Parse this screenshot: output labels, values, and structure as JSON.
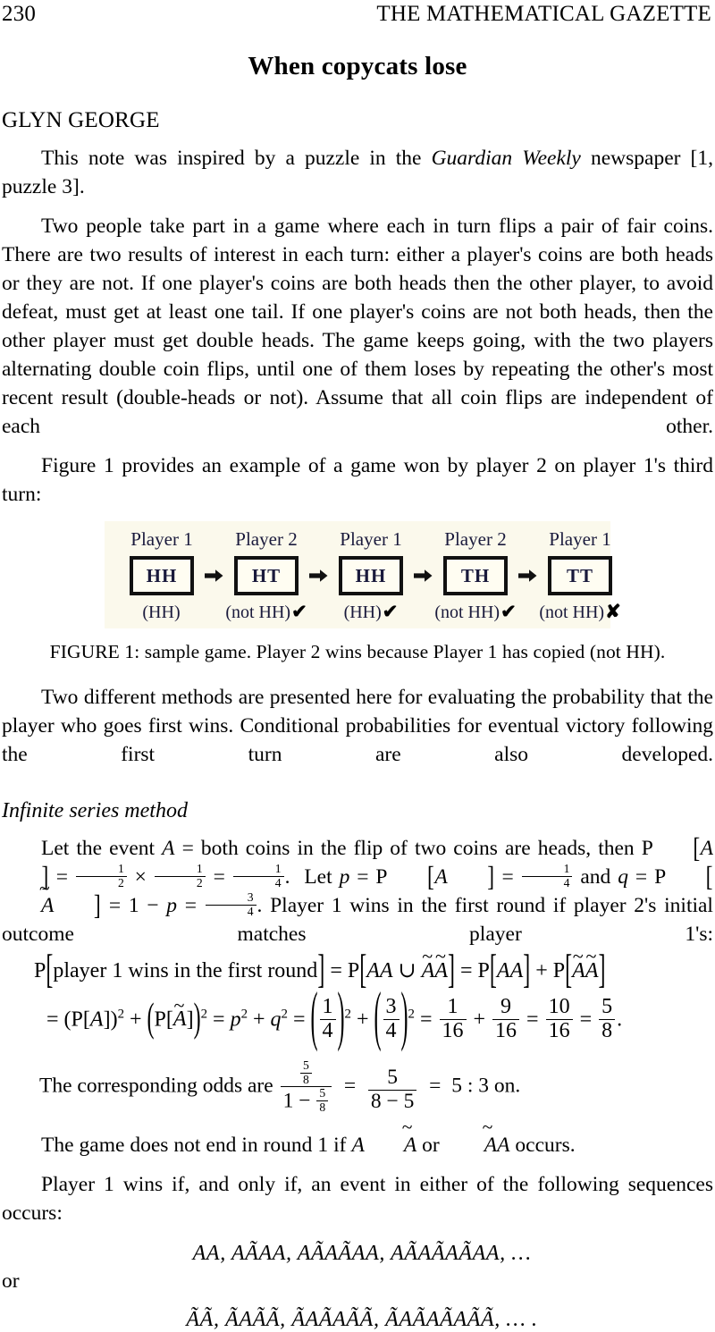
{
  "header": {
    "page_number": "230",
    "journal_name": "THE MATHEMATICAL GAZETTE"
  },
  "title": "When copycats lose",
  "author": "GLYN GEORGE",
  "paragraphs": {
    "intro_1": "This note was inspired by a puzzle in the ",
    "intro_1_italic": "Guardian Weekly",
    "intro_1_end": " newspaper [1, puzzle 3].",
    "rules": "Two people take part in a game where each in turn flips a pair of fair coins.   There are two results of interest in each turn:  either a player's coins are both heads or they are not.    If one player's coins are both heads then the other player, to avoid defeat, must get at least one tail.   If one player's coins are not both heads, then the other player must get double heads.   The game keeps going, with the two players alternating double coin flips, until one of them loses by repeating the other's most recent result (double-heads or not). Assume that all coin flips are independent of each other.",
    "figure_intro": "Figure 1 provides an example of a game won by player 2 on player 1's third turn:",
    "methods": "Two different methods are presented here for evaluating the probability that the player who goes first wins.   Conditional probabilities for eventual victory following the first turn are also developed.",
    "no_end_round1_pre": "The game does not end in round 1 if ",
    "no_end_round1_mid": " or ",
    "no_end_round1_end": " occurs.",
    "wins_iff": "Player 1 wins if, and only if, an event in either of the following sequences occurs:",
    "or": "or"
  },
  "figure": {
    "background_color": "#fbf9ec",
    "columns": [
      {
        "player": "Player 1",
        "outcome": "HH",
        "result": "(HH)",
        "mark": ""
      },
      {
        "player": "Player 2",
        "outcome": "HT",
        "result": "(not HH)",
        "mark": "✔"
      },
      {
        "player": "Player 1",
        "outcome": "HH",
        "result": "(HH)",
        "mark": "✔"
      },
      {
        "player": "Player 2",
        "outcome": "TH",
        "result": "(not HH)",
        "mark": "✔"
      },
      {
        "player": "Player 1",
        "outcome": "TT",
        "result": "(not HH)",
        "mark": "✘"
      }
    ],
    "arrow_icon": "right-arrow-icon",
    "caption": "FIGURE 1:  sample game.   Player 2 wins because Player 1 has copied (not HH)."
  },
  "section": {
    "heading": "Infinite series method"
  },
  "math": {
    "let_event_pre": "Let the event ",
    "let_event_A": "A",
    "let_event_post": " = both coins in the flip of two coins are heads, then",
    "p_of_A_label": "P",
    "half": {
      "num": "1",
      "den": "2"
    },
    "quarter": {
      "num": "1",
      "den": "4"
    },
    "three_quarters": {
      "num": "3",
      "den": "4"
    },
    "times_symbol": "×",
    "equals": "=",
    "let_p": "Let",
    "and": "and",
    "minus": "−",
    "p_var": "p",
    "q_var": "q",
    "one": "1",
    "player1_first_round": "Player 1 wins in the first round if player 2's initial outcome matches player 1's:",
    "eq1": {
      "lhs": "P[player 1 wins in the first round]",
      "text_inside": "player 1 wins in the first round",
      "union_symbol": "∪"
    },
    "eq2": {
      "sixteenth_1": {
        "num": "1",
        "den": "16"
      },
      "sixteenth_9": {
        "num": "9",
        "den": "16"
      },
      "sixteenth_10": {
        "num": "10",
        "den": "16"
      },
      "five_eighths": {
        "num": "5",
        "den": "8"
      },
      "period": "."
    },
    "odds": {
      "lead_text": "The corresponding odds are",
      "numerator_frac": {
        "num": "5",
        "den": "8"
      },
      "denominator_one": "1",
      "denominator_minus": "−",
      "denominator_frac": {
        "num": "5",
        "den": "8"
      },
      "second_num": "5",
      "second_den_left": "8",
      "second_den_minus": "−",
      "second_den_right": "5",
      "result": "5  :  3 on."
    },
    "sequences": {
      "line1": "AA, AÃAA, AÃAÃAA, AÃAÃAÃAA, …",
      "line2": "ÃÃ, ÃAÃÃ, ÃAÃAÃÃ, ÃAÃAÃAÃÃ, … ."
    }
  }
}
